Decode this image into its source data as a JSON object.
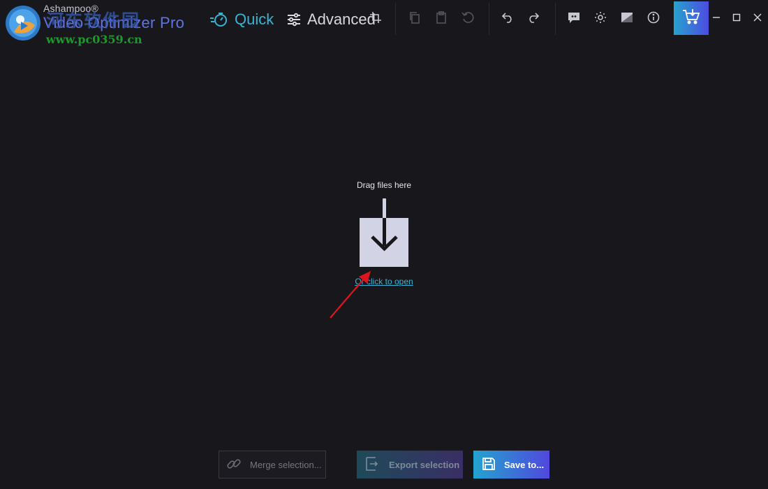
{
  "titlebar": {
    "brand": "Ashampoo®",
    "app_name": "Video Optimizer Pro",
    "watermark_text": "河东软件园",
    "watermark_url": "www.pc0359.cn"
  },
  "modes": {
    "quick": "Quick",
    "advanced": "Advanced",
    "active": "Quick"
  },
  "toolbar": {
    "icons": [
      "crop-icon",
      "copy-icon",
      "paste-icon",
      "reset-icon",
      "undo-icon",
      "redo-icon",
      "feedback-icon",
      "settings-icon",
      "image-icon",
      "info-icon",
      "cart-icon"
    ],
    "disabled": [
      "copy-icon",
      "paste-icon",
      "reset-icon"
    ]
  },
  "window_controls": [
    "minimize-icon",
    "maximize-icon",
    "close-icon"
  ],
  "dropzone": {
    "label": "Drag files here",
    "link": "Or click to open"
  },
  "bottom": {
    "merge_label": "Merge selection...",
    "export_label": "Export selection",
    "save_label": "Save to..."
  },
  "colors": {
    "background": "#18171c",
    "accent_cyan": "#36b6d6",
    "accent_purple": "#5048dd",
    "drop_box": "#d2d4e6",
    "annotation_red": "#e0141c"
  }
}
